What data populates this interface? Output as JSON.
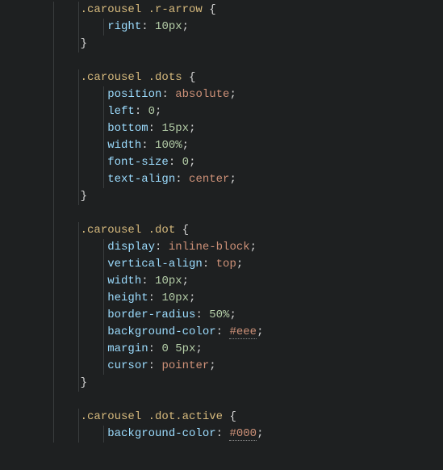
{
  "code": {
    "rules": [
      {
        "selector": ".carousel .r-arrow",
        "declarations": [
          {
            "prop": "right",
            "value": "10px",
            "kind": "num"
          }
        ]
      },
      {
        "selector": ".carousel .dots",
        "declarations": [
          {
            "prop": "position",
            "value": "absolute",
            "kind": "key"
          },
          {
            "prop": "left",
            "value": "0",
            "kind": "num"
          },
          {
            "prop": "bottom",
            "value": "15px",
            "kind": "num"
          },
          {
            "prop": "width",
            "value": "100%",
            "kind": "num"
          },
          {
            "prop": "font-size",
            "value": "0",
            "kind": "num"
          },
          {
            "prop": "text-align",
            "value": "center",
            "kind": "key"
          }
        ]
      },
      {
        "selector": ".carousel .dot",
        "declarations": [
          {
            "prop": "display",
            "value": "inline-block",
            "kind": "key"
          },
          {
            "prop": "vertical-align",
            "value": "top",
            "kind": "key"
          },
          {
            "prop": "width",
            "value": "10px",
            "kind": "num"
          },
          {
            "prop": "height",
            "value": "10px",
            "kind": "num"
          },
          {
            "prop": "border-radius",
            "value": "50%",
            "kind": "num"
          },
          {
            "prop": "background-color",
            "value": "#eee",
            "kind": "hex"
          },
          {
            "prop": "margin",
            "value": "0 5px",
            "kind": "num"
          },
          {
            "prop": "cursor",
            "value": "pointer",
            "kind": "key"
          }
        ]
      },
      {
        "selector": ".carousel .dot.active",
        "declarations": [
          {
            "prop": "background-color",
            "value": "#000",
            "kind": "hex"
          }
        ],
        "unclosed": true
      }
    ]
  }
}
